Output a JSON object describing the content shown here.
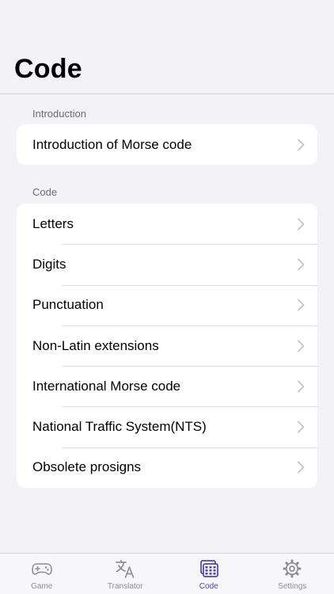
{
  "nav": {
    "title": "Code"
  },
  "sections": [
    {
      "header": "Introduction",
      "items": [
        {
          "label": "Introduction of Morse code"
        }
      ]
    },
    {
      "header": "Code",
      "items": [
        {
          "label": "Letters"
        },
        {
          "label": "Digits"
        },
        {
          "label": "Punctuation"
        },
        {
          "label": "Non-Latin extensions"
        },
        {
          "label": "International Morse code"
        },
        {
          "label": "National Traffic System(NTS)"
        },
        {
          "label": "Obsolete prosigns"
        }
      ]
    }
  ],
  "tabbar": {
    "tabs": [
      {
        "label": "Game",
        "icon": "gamepad-icon"
      },
      {
        "label": "Translator",
        "icon": "translate-icon"
      },
      {
        "label": "Code",
        "icon": "code-table-icon",
        "active": true
      },
      {
        "label": "Settings",
        "icon": "gear-icon"
      }
    ]
  },
  "colors": {
    "accent": "#4b42c7",
    "inactive": "#8e8e93",
    "background": "#f2f2f7",
    "card": "#ffffff"
  }
}
